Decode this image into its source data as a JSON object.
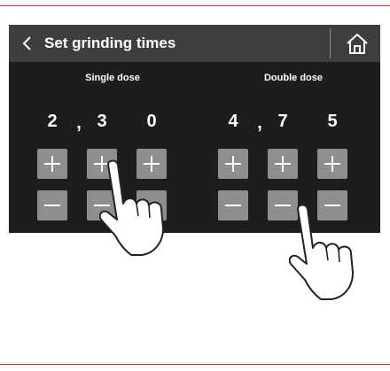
{
  "header": {
    "title": "Set grinding times",
    "back_icon": "chevron-left-icon",
    "home_icon": "home-icon"
  },
  "single_dose": {
    "label": "Single dose",
    "digits": [
      "2",
      "3",
      "0"
    ],
    "separator": ","
  },
  "double_dose": {
    "label": "Double dose",
    "digits": [
      "4",
      "7",
      "5"
    ],
    "separator": ","
  },
  "controls": {
    "increment_icon": "plus-icon",
    "decrement_icon": "minus-icon"
  },
  "colors": {
    "screen_background": "#1d1d1d",
    "header_background": "#3e3e3e",
    "button": "#8e8e8e",
    "page_rule": "#b5402c"
  }
}
